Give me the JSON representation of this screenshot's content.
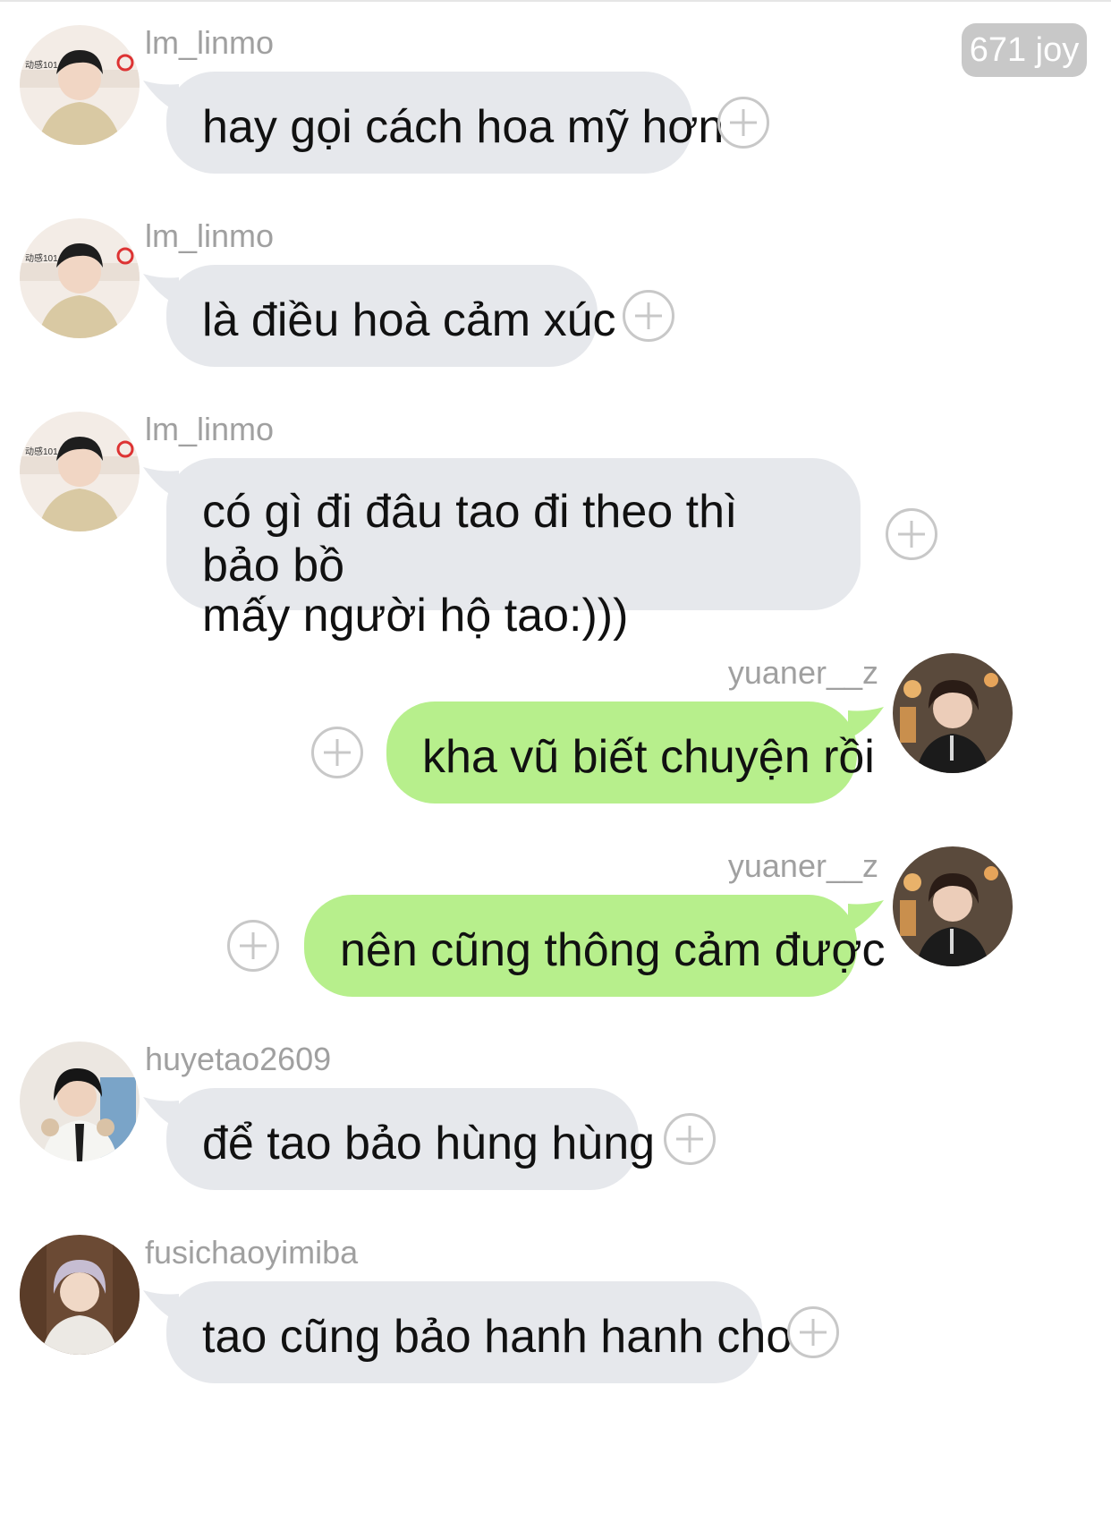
{
  "badge": {
    "label": "671 joy"
  },
  "messages": [
    {
      "user": "lm_linmo",
      "text": "hay gọi cách hoa mỹ hơn",
      "side": "left",
      "avatar": "avatar-lm-linmo"
    },
    {
      "user": "lm_linmo",
      "text": "là điều hoà cảm xúc",
      "side": "left",
      "avatar": "avatar-lm-linmo"
    },
    {
      "user": "lm_linmo",
      "text_line1": "có gì đi đâu tao đi theo thì bảo bồ",
      "text_line2": "mấy người hộ tao:)))",
      "side": "left",
      "avatar": "avatar-lm-linmo"
    },
    {
      "user": "yuaner__z",
      "text": "kha vũ biết chuyện rồi",
      "side": "right",
      "avatar": "avatar-yuaner-z"
    },
    {
      "user": "yuaner__z",
      "text": "nên cũng thông cảm được",
      "side": "right",
      "avatar": "avatar-yuaner-z"
    },
    {
      "user": "huyetao2609",
      "text": "để tao bảo hùng hùng",
      "side": "left",
      "avatar": "avatar-huyetao2609"
    },
    {
      "user": "fusichaoyimiba",
      "text": "tao cũng bảo hanh hanh cho",
      "side": "left",
      "avatar": "avatar-fusichaoyimiba"
    }
  ],
  "colors": {
    "incoming_bubble": "#e6e8ec",
    "outgoing_bubble": "#b7ef8c",
    "username": "#a0a0a0",
    "badge_bg": "#c8c8c8"
  },
  "icons": {
    "add_reaction": "plus-circle-icon"
  }
}
